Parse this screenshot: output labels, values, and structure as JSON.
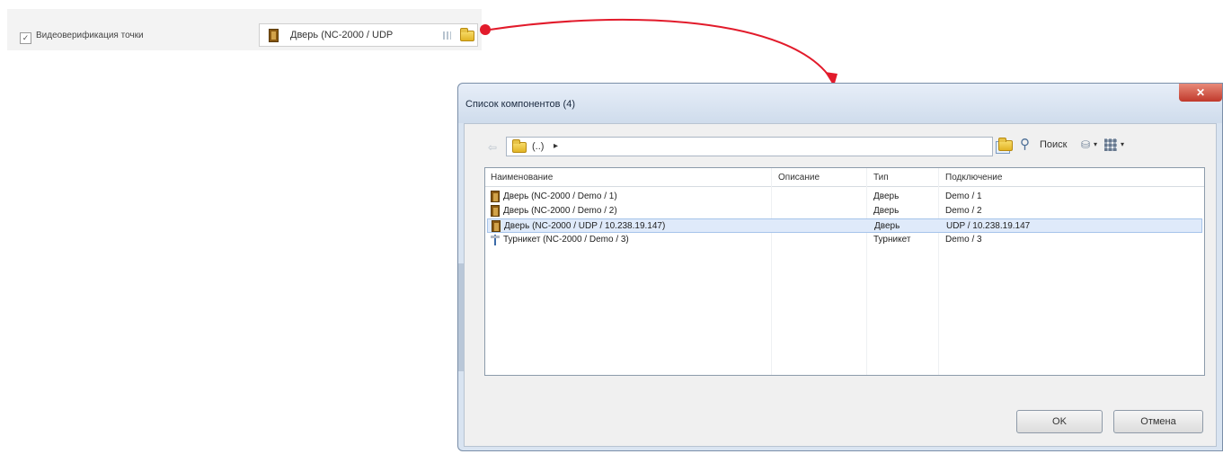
{
  "property": {
    "label": "Видеоверификация точки",
    "checked": true,
    "value": "Дверь (NC-2000 / UDP"
  },
  "dialog": {
    "title": "Список компонентов (4)",
    "close_label": "✕",
    "path": "(..)",
    "search_label": "Поиск",
    "columns": [
      "Наименование",
      "Описание",
      "Тип",
      "Подключение"
    ],
    "rows": [
      {
        "name": "Дверь (NC-2000 / Demo / 1)",
        "description": "",
        "type": "Дверь",
        "connection": "Demo / 1",
        "icon": "door-icon",
        "selected": false
      },
      {
        "name": "Дверь (NC-2000 / Demo / 2)",
        "description": "",
        "type": "Дверь",
        "connection": "Demo / 2",
        "icon": "door-icon",
        "selected": false
      },
      {
        "name": "Дверь (NC-2000 / UDP / 10.238.19.147)",
        "description": "",
        "type": "Дверь",
        "connection": "UDP / 10.238.19.147",
        "icon": "door-icon",
        "selected": true
      },
      {
        "name": "Турникет (NC-2000 / Demo / 3)",
        "description": "",
        "type": "Турникет",
        "connection": "Demo / 3",
        "icon": "turnstile-icon",
        "selected": false
      }
    ],
    "ok_label": "OK",
    "cancel_label": "Отмена"
  },
  "colors": {
    "arrow": "#e21b2b",
    "selection": "#dfeafa"
  }
}
